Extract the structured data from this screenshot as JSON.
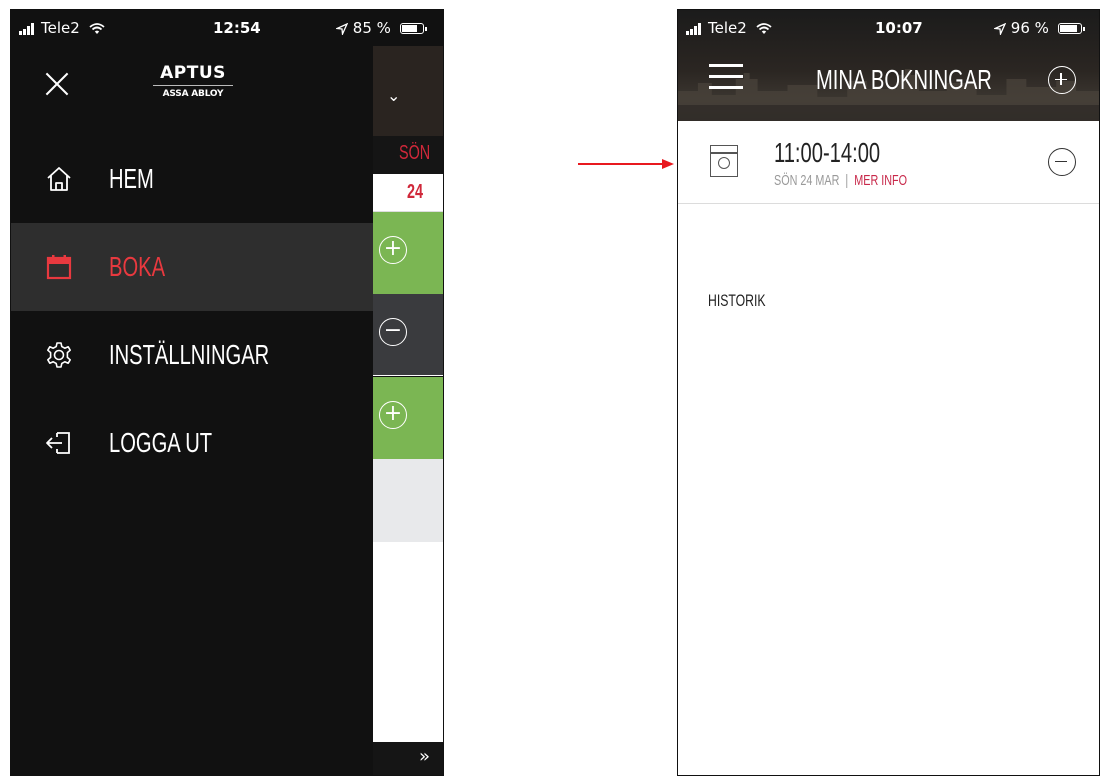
{
  "left_phone": {
    "status": {
      "carrier": "Tele2",
      "time": "12:54",
      "battery": "85 %",
      "battery_level": 0.85
    },
    "logo": {
      "main": "APTUS",
      "sub": "ASSA ABLOY"
    },
    "menu": [
      {
        "label": "HEM",
        "icon": "home-icon",
        "active": false
      },
      {
        "label": "BOKA",
        "icon": "calendar-icon",
        "active": true
      },
      {
        "label": "INSTÄLLNINGAR",
        "icon": "gear-icon",
        "active": false
      },
      {
        "label": "LOGGA UT",
        "icon": "logout-icon",
        "active": false
      }
    ],
    "background_peek": {
      "day": "SÖN",
      "date": "24",
      "footer": "»"
    }
  },
  "right_phone": {
    "status": {
      "carrier": "Tele2",
      "time": "10:07",
      "battery": "96 %",
      "battery_level": 0.96
    },
    "title": "MINA BOKNINGAR",
    "booking": {
      "time": "11:00-14:00",
      "date": "SÖN 24 MAR",
      "separator": "|",
      "more_info": "MER INFO",
      "icon": "washing-machine-icon"
    },
    "history_label": "HISTORIK"
  },
  "colors": {
    "accent_red": "#e8393f",
    "date_red": "#d0283a",
    "info_red": "#c8284a",
    "green": "#7bb653",
    "dark": "#111111"
  }
}
